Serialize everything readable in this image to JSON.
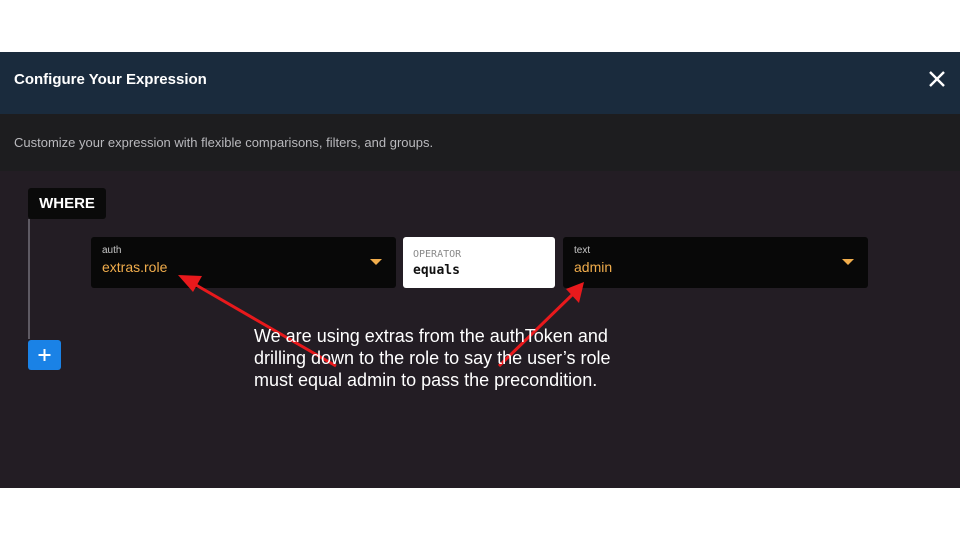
{
  "modal": {
    "title": "Configure Your Expression",
    "subtitle": "Customize your expression with flexible comparisons, filters, and groups."
  },
  "builder": {
    "where_label": "WHERE",
    "left_field": {
      "label": "auth",
      "value": "extras.role"
    },
    "operator": {
      "label": "OPERATOR",
      "value": "equals"
    },
    "right_field": {
      "label": "text",
      "value": "admin"
    },
    "add_label": "+"
  },
  "annotation": {
    "lines": [
      "We are using extras from the authToken and",
      "drilling down to the role to say the user’s role",
      "must equal admin to pass the precondition."
    ]
  },
  "colors": {
    "header_bg": "#1a2b3d",
    "body_bg": "#231d24",
    "accent": "#f1ad4c",
    "add_button": "#1a82e6",
    "arrow": "#e8191c"
  },
  "icons": {
    "close": "close-icon",
    "add": "plus-icon",
    "dropdown": "chevron-down-icon"
  }
}
